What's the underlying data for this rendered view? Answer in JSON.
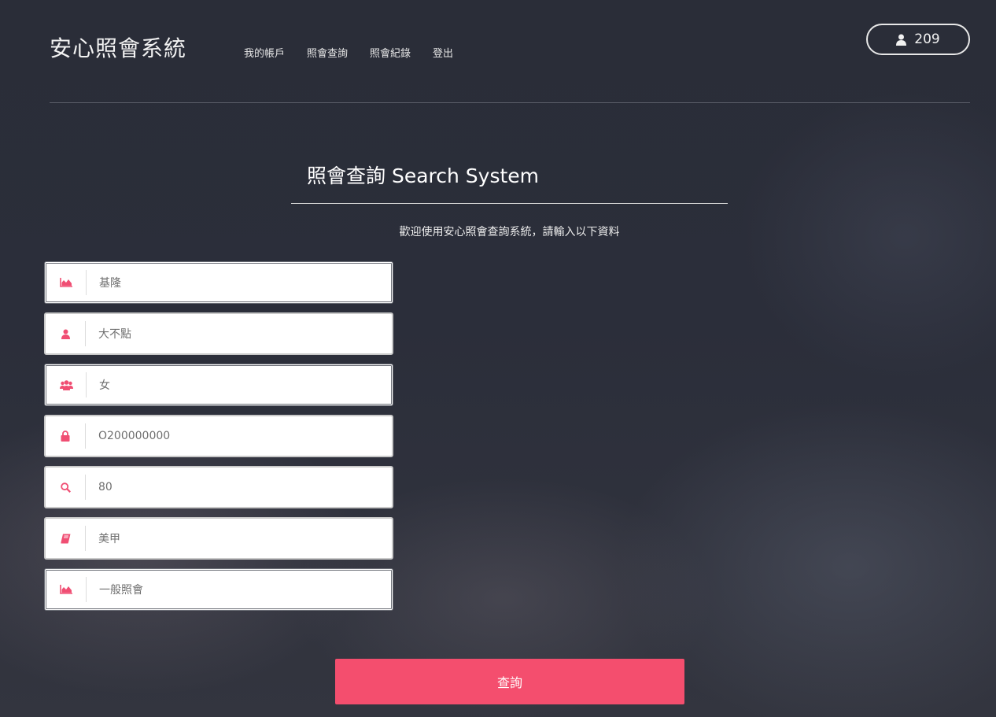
{
  "header": {
    "brand": "安心照會系統",
    "nav": [
      "我的帳戶",
      "照會查詢",
      "照會紀錄",
      "登出"
    ],
    "user_count": "209",
    "user_icon": "user-icon"
  },
  "panel": {
    "title": "照會查詢 Search System",
    "subtitle": "歡迎使用安心照會查詢系統，請輸入以下資料"
  },
  "fields": [
    {
      "icon": "area-chart-icon",
      "value": "基隆"
    },
    {
      "icon": "user-icon",
      "value": "大不點"
    },
    {
      "icon": "users-icon",
      "value": "女"
    },
    {
      "icon": "lock-icon",
      "value": "O200000000"
    },
    {
      "icon": "search-icon",
      "value": "80"
    },
    {
      "icon": "book-icon",
      "value": "美甲"
    },
    {
      "icon": "area-chart-icon",
      "value": "一般照會"
    }
  ],
  "submit_label": "查詢",
  "colors": {
    "accent": "#f44e6e",
    "background": "#2b2e3a"
  }
}
